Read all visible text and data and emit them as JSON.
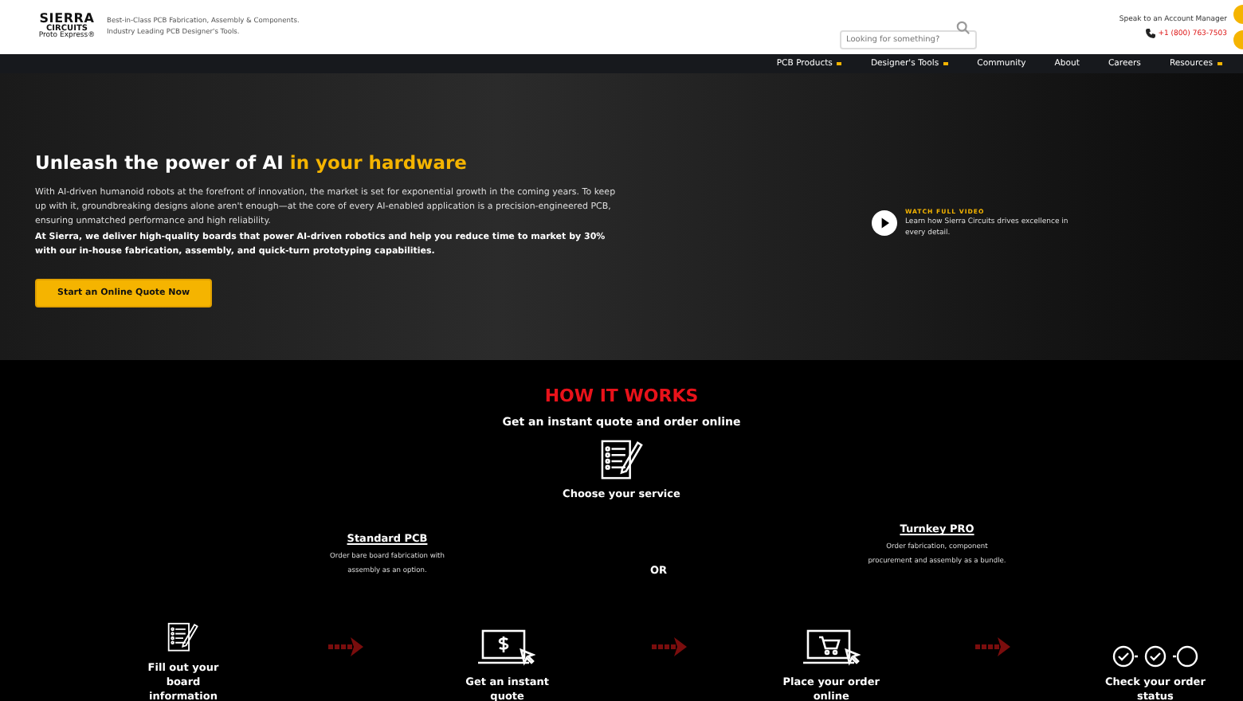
{
  "header": {
    "logo": {
      "line_1": "SIERRA",
      "line_2": "CIRCUITS",
      "line_3": "Proto Express®"
    },
    "tagline": [
      "Best-in-Class PCB Fabrication, Assembly & Components.",
      "Industry Leading PCB Designer's Tools."
    ],
    "search": {
      "placeholder": "Looking for something?"
    },
    "contact": {
      "label": "Speak to an Account Manager",
      "phone": "+1 (800) 763-7503"
    }
  },
  "nav": [
    {
      "label": "PCB Products",
      "dropdown": true
    },
    {
      "label": "Designer's Tools",
      "dropdown": true
    },
    {
      "label": "Community",
      "dropdown": false
    },
    {
      "label": "About",
      "dropdown": false
    },
    {
      "label": "Careers",
      "dropdown": false
    },
    {
      "label": "Resources",
      "dropdown": true
    }
  ],
  "hero": {
    "title": "Unleash the power of AI",
    "title_highlight": "in your hardware",
    "paragraph": "With AI-driven humanoid robots at the forefront of innovation, the market is set for exponential growth in the coming years. To keep up with it, groundbreaking designs alone aren't enough—at the core of every AI-enabled application is a precision-engineered PCB, ensuring unmatched performance and high reliability.",
    "bold_paragraph": "At Sierra, we deliver high-quality boards that power AI-driven robotics and help you reduce time to market by 30% with our in-house fabrication, assembly, and quick-turn prototyping capabilities.",
    "button": "Start an Online Quote Now",
    "video": {
      "label": "WATCH FULL VIDEO",
      "text": "Learn how Sierra Circuits drives excellence in every detail."
    }
  },
  "how_it_works": {
    "title": "HOW IT WORKS",
    "subtitle": "Get an instant quote and order online",
    "choose": "Choose your service",
    "or": "OR",
    "services": [
      {
        "name": "Standard PCB",
        "description": "Order bare board fabrication with assembly as an option."
      },
      {
        "name": "Turnkey PRO",
        "description": "Order fabrication, component procurement and assembly as a bundle."
      }
    ],
    "steps": [
      {
        "kind": "form",
        "label": "Fill out your board information"
      },
      {
        "kind": "quote",
        "label": "Get an instant quote"
      },
      {
        "kind": "cart",
        "label": "Place your order online"
      },
      {
        "kind": "status",
        "label": "Check your order status"
      }
    ]
  }
}
